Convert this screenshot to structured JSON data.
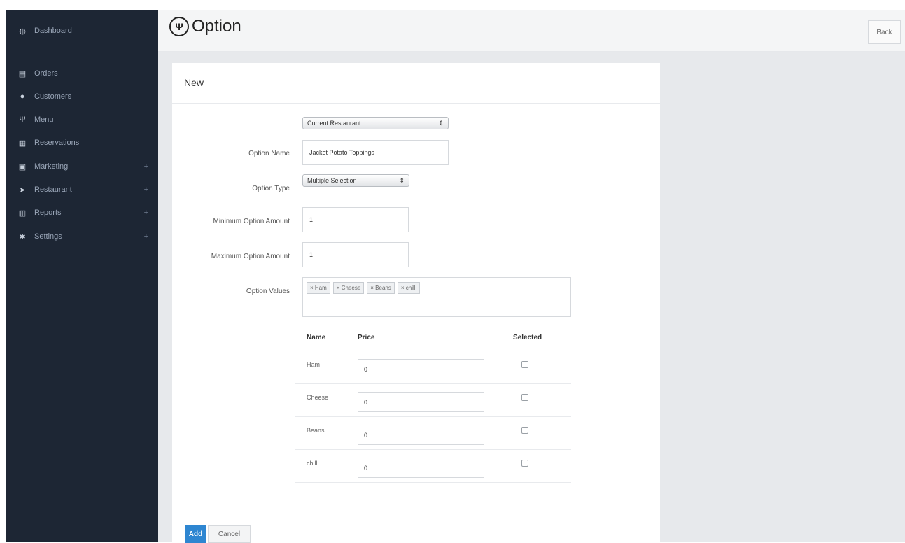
{
  "sidebar": {
    "items": [
      {
        "icon": "dashboard-icon",
        "glyph": "◍",
        "label": "Dashboard",
        "expandable": false
      },
      {
        "icon": "cart-icon",
        "glyph": "▤",
        "label": "Orders",
        "expandable": false
      },
      {
        "icon": "users-icon",
        "glyph": "●",
        "label": "Customers",
        "expandable": false
      },
      {
        "icon": "cutlery-icon",
        "glyph": "Ψ",
        "label": "Menu",
        "expandable": false
      },
      {
        "icon": "calendar-icon",
        "glyph": "▦",
        "label": "Reservations",
        "expandable": false
      },
      {
        "icon": "marketing-icon",
        "glyph": "▣",
        "label": "Marketing",
        "expandable": true
      },
      {
        "icon": "send-icon",
        "glyph": "➤",
        "label": "Restaurant",
        "expandable": true
      },
      {
        "icon": "bar-chart-icon",
        "glyph": "▥",
        "label": "Reports",
        "expandable": true
      },
      {
        "icon": "gear-icon",
        "glyph": "✱",
        "label": "Settings",
        "expandable": true
      }
    ],
    "expand_glyph": "+"
  },
  "header": {
    "title": "Option",
    "title_icon": "cutlery-icon",
    "title_glyph": "Ψ",
    "back_label": "Back"
  },
  "panel": {
    "heading": "New",
    "restaurant_select": "Current Restaurant",
    "option_name_label": "Option Name",
    "option_name_value": "Jacket Potato Toppings",
    "option_type_label": "Option Type",
    "option_type_value": "Multiple Selection",
    "min_label": "Minimum Option Amount",
    "min_value": "1",
    "max_label": "Maximum Option Amount",
    "max_value": "1",
    "values_label": "Option Values",
    "tags": [
      "× Ham",
      "× Cheese",
      "× Beans",
      "× chilli"
    ],
    "select_arrow": "⇕"
  },
  "table": {
    "headers": {
      "name": "Name",
      "price": "Price",
      "selected": "Selected"
    },
    "rows": [
      {
        "name": "Ham",
        "price": "0",
        "selected": false
      },
      {
        "name": "Cheese",
        "price": "0",
        "selected": false
      },
      {
        "name": "Beans",
        "price": "0",
        "selected": false
      },
      {
        "name": "chilli",
        "price": "0",
        "selected": false
      }
    ]
  },
  "footer": {
    "add_label": "Add",
    "cancel_label": "Cancel"
  },
  "colors": {
    "sidebar_bg": "#1d2634",
    "content_bg": "#e7e9ec",
    "primary": "#2e86d1"
  }
}
